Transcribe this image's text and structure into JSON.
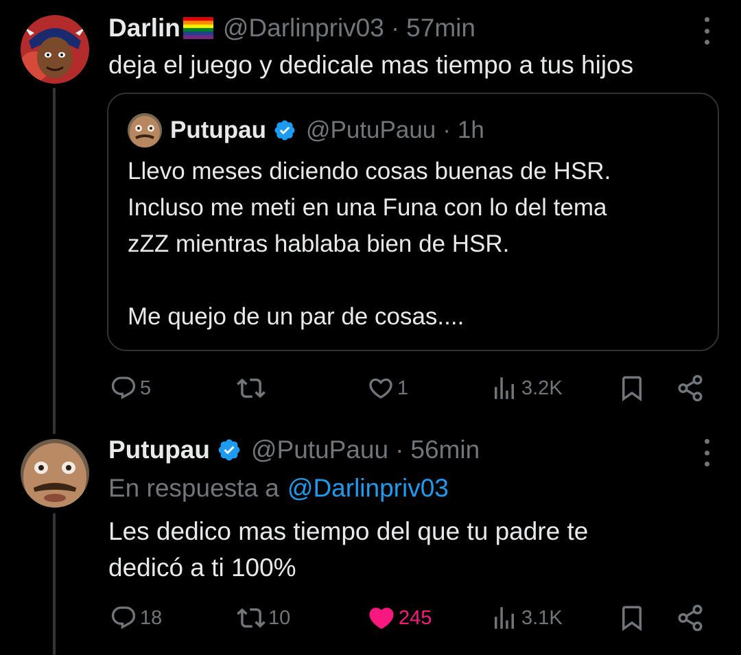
{
  "tweet1": {
    "author_name": "Darlin",
    "author_flag": "🏳️‍🌈",
    "handle": "@Darlinpriv03",
    "separator": "·",
    "time": "57min",
    "text": "deja el juego y dedicale mas tiempo a tus hijos",
    "quoted": {
      "author_name": "Putupau",
      "handle": "@PutuPauu",
      "separator": "·",
      "time": "1h",
      "text": "Llevo meses diciendo cosas buenas de HSR.\nIncluso me meti en una Funa con lo del tema\nzZZ mientras hablaba bien de HSR.\n\nMe quejo de un par de cosas...."
    },
    "actions": {
      "replies": "5",
      "reposts": "",
      "likes": "1",
      "views": "3.2K"
    }
  },
  "tweet2": {
    "author_name": "Putupau",
    "handle": "@PutuPauu",
    "separator": "·",
    "time": "56min",
    "reply_to_label": "En respuesta a",
    "reply_to_handle": "@Darlinpriv03",
    "text": "Les dedico mas tiempo del que tu padre te\ndedicó a ti 100%",
    "actions": {
      "replies": "18",
      "reposts": "10",
      "likes": "245",
      "views": "3.1K"
    }
  },
  "icons": {
    "reply": "reply-icon",
    "repost": "repost-icon",
    "like": "heart-icon",
    "views": "views-icon",
    "bookmark": "bookmark-icon",
    "share": "share-icon",
    "more": "more-icon",
    "verified": "verified-badge-icon"
  },
  "colors": {
    "background": "#000000",
    "text": "#e7e9ea",
    "muted": "#71767b",
    "link": "#1d9bf0",
    "liked": "#f91880",
    "verified": "#1d9bf0",
    "border": "#2f3336"
  }
}
